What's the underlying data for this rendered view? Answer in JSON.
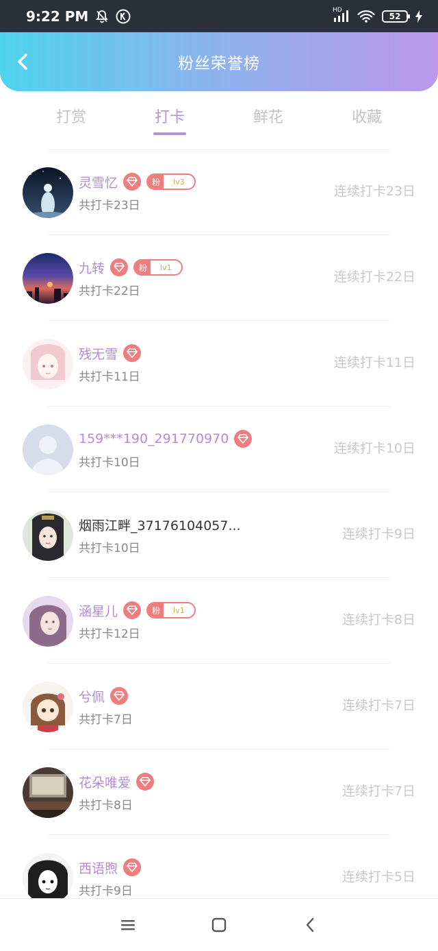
{
  "status_bar": {
    "time": "9:22 PM",
    "signal_label": "HD",
    "battery": "52"
  },
  "header": {
    "title": "粉丝荣誉榜"
  },
  "tabs": [
    {
      "label": "打赏",
      "active": false
    },
    {
      "label": "打卡",
      "active": true
    },
    {
      "label": "鲜花",
      "active": false
    },
    {
      "label": "收藏",
      "active": false
    }
  ],
  "rows": [
    {
      "name": "灵雪忆",
      "vip": true,
      "fan_badge": {
        "label": "粉",
        "level": "lv3"
      },
      "total": "共打卡23日",
      "streak": "连续打卡23日",
      "avatar": "night-sky-figure"
    },
    {
      "name": "九转",
      "vip": true,
      "fan_badge": {
        "label": "粉",
        "level": "lv1"
      },
      "total": "共打卡22日",
      "streak": "连续打卡22日",
      "avatar": "sunset-city"
    },
    {
      "name": "残无雪",
      "vip": true,
      "fan_badge": null,
      "total": "共打卡11日",
      "streak": "连续打卡11日",
      "avatar": "anime-girl-pink"
    },
    {
      "name": "159***190_291770970",
      "vip": true,
      "fan_badge": null,
      "total": "共打卡10日",
      "streak": "连续打卡10日",
      "avatar": "default-user"
    },
    {
      "name": "烟雨江畔_37176104057...",
      "vip": false,
      "fan_badge": null,
      "total": "共打卡10日",
      "streak": "连续打卡9日",
      "avatar": "ancient-lady"
    },
    {
      "name": "涵星儿",
      "vip": true,
      "fan_badge": {
        "label": "粉",
        "level": "lv1"
      },
      "total": "共打卡12日",
      "streak": "连续打卡8日",
      "avatar": "girl-portrait"
    },
    {
      "name": "兮佩",
      "vip": true,
      "fan_badge": null,
      "total": "共打卡7日",
      "streak": "连续打卡7日",
      "avatar": "cartoon-girl"
    },
    {
      "name": "花朵唯爱",
      "vip": true,
      "fan_badge": null,
      "total": "共打卡8日",
      "streak": "连续打卡7日",
      "avatar": "vintage-room"
    },
    {
      "name": "西语煦",
      "vip": true,
      "fan_badge": null,
      "total": "共打卡9日",
      "streak": "连续打卡5日",
      "avatar": "manga-girl"
    }
  ],
  "colors": {
    "accent": "#b890dd",
    "badge": "#ee7d7f",
    "header_start": "#4fd3ee",
    "header_end": "#bb98ea"
  }
}
